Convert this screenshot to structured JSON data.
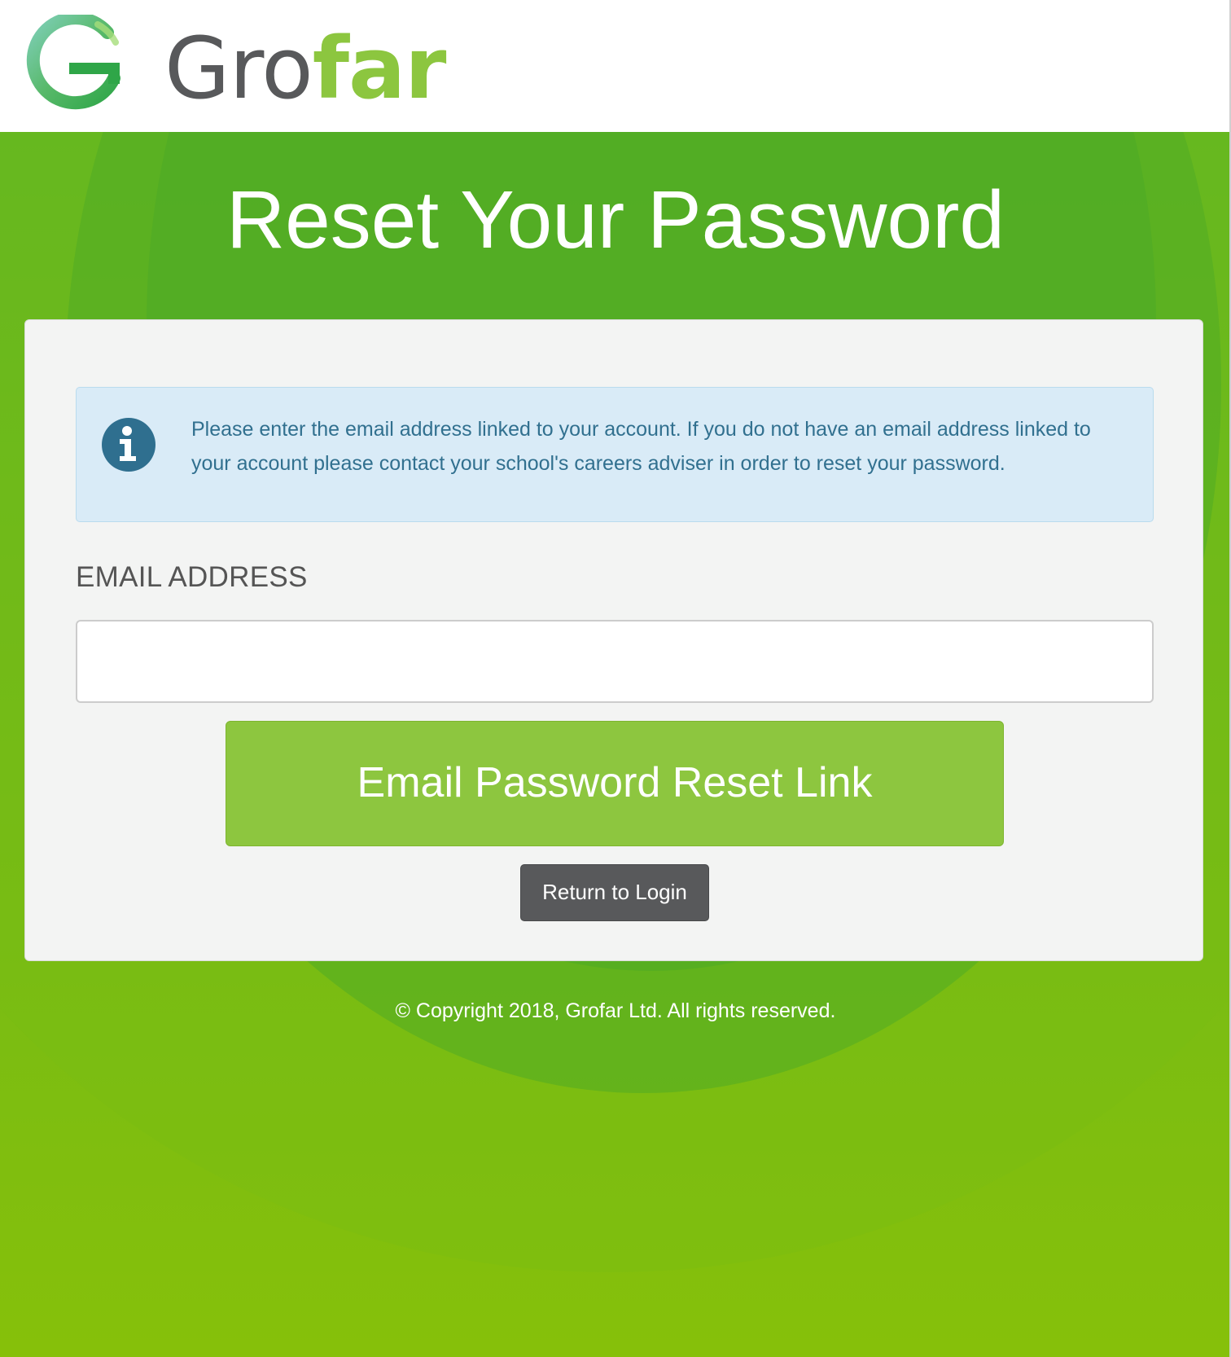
{
  "header": {
    "logo_text_part1": "Gro",
    "logo_text_part2": "far",
    "logo_colors": {
      "grey": "#58595b",
      "green": "#8cc63f"
    }
  },
  "page": {
    "title": "Reset Your Password",
    "background_color": "#8abf07"
  },
  "info_alert": {
    "icon": "info-icon",
    "text": "Please enter the email address linked to your account. If you do not have an email address linked to your account please contact your school's careers adviser in order to reset your password."
  },
  "form": {
    "email_label": "EMAIL ADDRESS",
    "email_value": "",
    "email_placeholder": "",
    "submit_label": "Email Password Reset Link",
    "submit_color": "#8dc63f",
    "login_label": "Return to Login",
    "login_color": "#58595b"
  },
  "footer": {
    "copyright": "© Copyright 2018, Grofar Ltd. All rights reserved."
  }
}
